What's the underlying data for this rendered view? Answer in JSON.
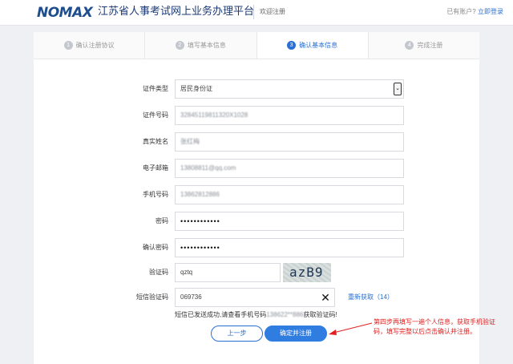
{
  "header": {
    "logo": "NOMAX",
    "site_title": "江苏省人事考试网上业务办理平台",
    "welcome": "欢迎注册",
    "account_prompt": "已有账户?",
    "login_link": "立即登录"
  },
  "steps": [
    {
      "num": "1",
      "label": "确认注册协议"
    },
    {
      "num": "2",
      "label": "填写基本信息"
    },
    {
      "num": "3",
      "label": "确认基本信息"
    },
    {
      "num": "4",
      "label": "完成注册"
    }
  ],
  "form": {
    "id_type": {
      "label": "证件类型",
      "value": "居民身份证"
    },
    "id_number": {
      "label": "证件号码",
      "value": "32845119811320X1028"
    },
    "real_name": {
      "label": "真实姓名",
      "value": "张红梅"
    },
    "email": {
      "label": "电子邮箱",
      "value": "13808811@qq.com"
    },
    "phone": {
      "label": "手机号码",
      "value": "13862812886"
    },
    "password": {
      "label": "密码",
      "value": "••••••••••••"
    },
    "confirm_password": {
      "label": "确认密码",
      "value": "••••••••••••"
    },
    "captcha": {
      "label": "验证码",
      "value": "qztq",
      "image_text": "azB9"
    },
    "sms_code": {
      "label": "短信验证码",
      "value": "069736",
      "resend": "重新获取（14）"
    }
  },
  "sms_note": {
    "prefix": "短信已发送成功,请查看手机号码",
    "masked": "138622**886",
    "suffix": "获取验证码!"
  },
  "buttons": {
    "prev": "上一步",
    "submit": "确定并注册"
  },
  "annotation": "第四步再填写一遍个人信息，获取手机验证码，填写完整以后点击确认并注册。",
  "colors": {
    "accent": "#2a6fd6",
    "annotation": "#e02020",
    "brand": "#1f4e8c"
  }
}
